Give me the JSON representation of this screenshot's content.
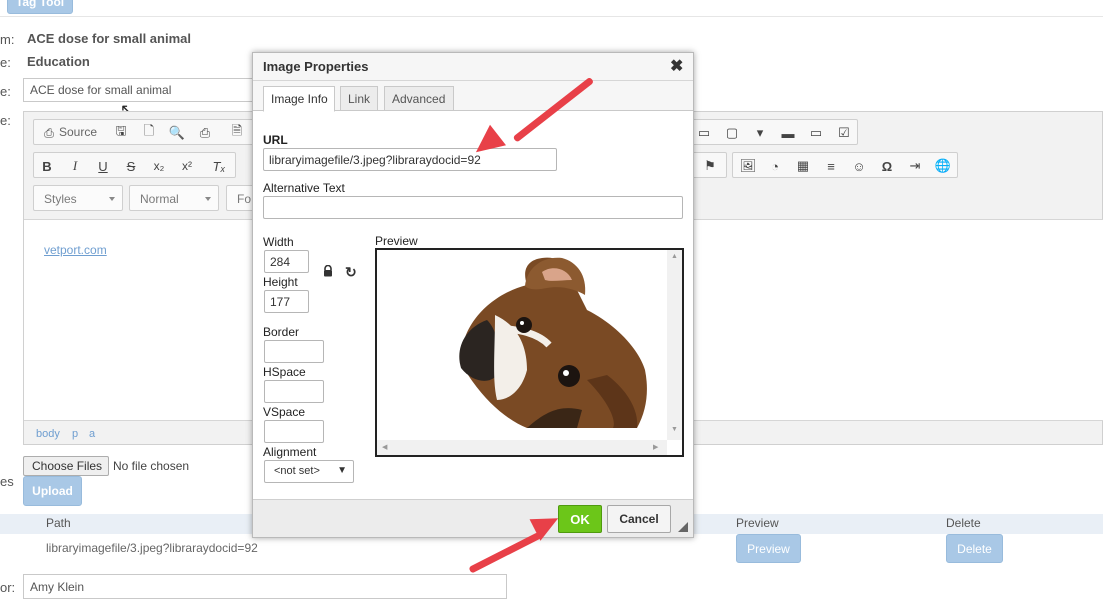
{
  "top": {
    "tag_tool_label": "Tag Tool"
  },
  "form": {
    "left_labels": [
      "m:",
      "e:",
      "e:",
      "e:"
    ],
    "item_value": "ACE dose for small animal",
    "type_value": "Education",
    "title_input": "ACE dose for small animal",
    "files_label": "es",
    "author_label": "or:",
    "author_input": "Amy Klein"
  },
  "editor": {
    "source_label": "Source",
    "styles_combo": "Styles",
    "format_combo": "Normal",
    "font_combo": "Fo",
    "link_text": "vetport.com",
    "path_items": [
      "body",
      "p",
      "a"
    ]
  },
  "upload": {
    "choose_label": "Choose Files",
    "no_file_text": "No file chosen",
    "upload_label": "Upload"
  },
  "files_table": {
    "headers": {
      "path": "Path",
      "preview": "Preview",
      "delete": "Delete"
    },
    "row": {
      "path": "libraryimagefile/3.jpeg?libraraydocid=92",
      "preview_btn": "Preview",
      "delete_btn": "Delete"
    }
  },
  "dialog": {
    "title": "Image Properties",
    "tabs": [
      "Image Info",
      "Link",
      "Advanced"
    ],
    "url_label": "URL",
    "url_value": "libraryimagefile/3.jpeg?libraraydocid=92",
    "alt_label": "Alternative Text",
    "alt_value": "",
    "width_label": "Width",
    "width_value": "284",
    "height_label": "Height",
    "height_value": "177",
    "border_label": "Border",
    "hspace_label": "HSpace",
    "vspace_label": "VSpace",
    "alignment_label": "Alignment",
    "alignment_value": "<not set>",
    "preview_label": "Preview",
    "ok_label": "OK",
    "cancel_label": "Cancel"
  },
  "colors": {
    "accent_red": "#e84048",
    "ok_green": "#6cc619",
    "light_blue": "#a9c8e6",
    "link": "#6f9ed0"
  }
}
